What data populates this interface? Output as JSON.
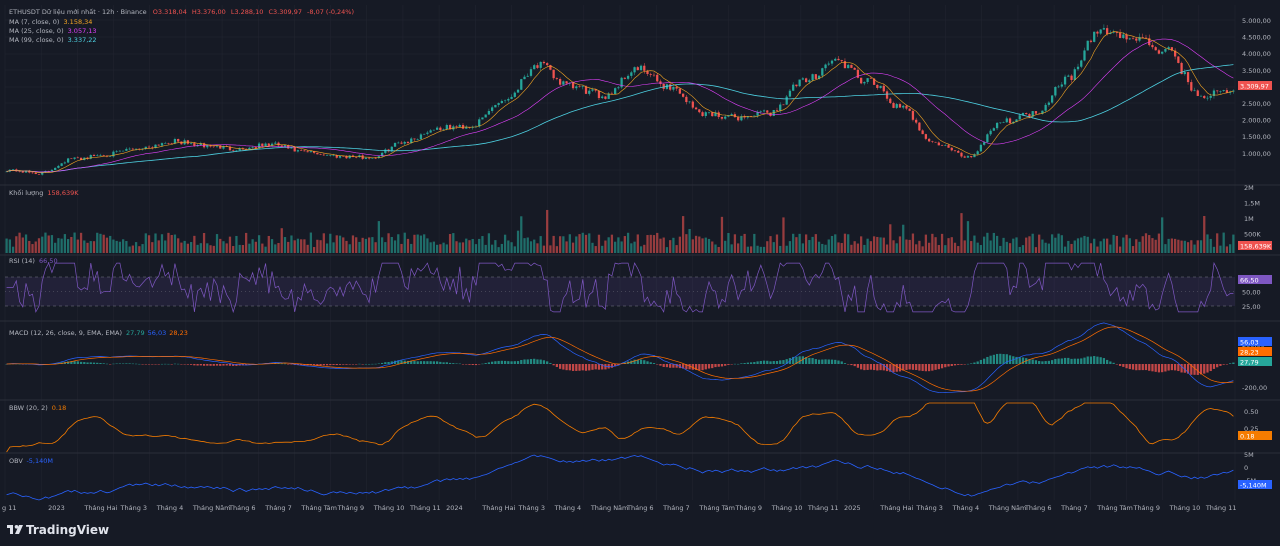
{
  "header": {
    "symbol_line": "ETHUSDT Dữ liệu mới nhất · 12h · Binance",
    "open": "O3.318,04",
    "high": "H3.376,00",
    "low": "L3.288,10",
    "close": "C3.309,97",
    "change": "-8,07 (-0,24%)"
  },
  "ma_legend": [
    {
      "label": "MA (7, close, 0)",
      "value": "3.158,34",
      "color": "#f5a623"
    },
    {
      "label": "MA (25, close, 0)",
      "value": "3.057,13",
      "color": "#e040fb"
    },
    {
      "label": "MA (99, close, 0)",
      "value": "3.337,22",
      "color": "#4dd0e1"
    }
  ],
  "panes": {
    "volume": {
      "label": "Khối lượng",
      "value": "158,639K",
      "badge": "158,639K"
    },
    "rsi": {
      "label": "RSI (14)",
      "value": "66,50",
      "badge": "66,50"
    },
    "macd": {
      "label": "MACD (12, 26, close, 9, EMA, EMA)",
      "v1": "27,79",
      "v2": "56,03",
      "v3": "28,23"
    },
    "bbw": {
      "label": "BBW (20, 2)",
      "value": "0.18",
      "badge": "0.18"
    },
    "obv": {
      "label": "OBV",
      "value": "-5,140M",
      "badge": "-5,140M"
    }
  },
  "price_badge": "3.309,97",
  "price_axis": [
    "5.000,00",
    "4.500,00",
    "4.000,00",
    "3.500,00",
    "3.000,00",
    "2.500,00",
    "2.000,00",
    "1.500,00",
    "1.000,00"
  ],
  "volume_axis": [
    "2M",
    "1,5M",
    "1M",
    "500K"
  ],
  "rsi_axis": [
    "75,00",
    "50,00",
    "25,00"
  ],
  "macd_axis": [
    "200,00",
    "-200,00"
  ],
  "bbw_axis": [
    "0.50",
    "0.25"
  ],
  "obv_axis": [
    "5M",
    "0",
    "-5M"
  ],
  "time_axis": [
    "g 11",
    "2023",
    "Tháng Hai",
    "Tháng 3",
    "Tháng 4",
    "Tháng Năm",
    "Tháng 6",
    "Tháng 7",
    "Tháng Tám",
    "Tháng 9",
    "Tháng 10",
    "Tháng 11",
    "2024",
    "Tháng Hai",
    "Tháng 3",
    "Tháng 4",
    "Tháng Năm",
    "Tháng 6",
    "Tháng 7",
    "Tháng Tám",
    "Tháng 9",
    "Tháng 10",
    "Tháng 11",
    "2025",
    "Tháng Hai",
    "Tháng 3",
    "Tháng 4",
    "Tháng Năm",
    "Tháng 6",
    "Tháng 7",
    "Tháng Tám",
    "Tháng 9",
    "Tháng 10",
    "Tháng 11"
  ],
  "brand": "TradingView",
  "colors": {
    "up": "#26a69a",
    "down": "#ef5350",
    "rsi": "#7e57c2",
    "bbw": "#f57c00",
    "obv": "#2962ff",
    "ma7": "#f5a623",
    "ma25": "#e040fb",
    "ma99": "#4dd0e1"
  },
  "chart_data": {
    "type": "line",
    "title": "ETHUSDT · 12h · Binance",
    "ylim": [
      1000,
      5000
    ],
    "x": [
      "2022-11",
      "2022-12",
      "2023-01",
      "2023-02",
      "2023-03",
      "2023-04",
      "2023-05",
      "2023-06",
      "2023-07",
      "2023-08",
      "2023-09",
      "2023-10",
      "2023-11",
      "2023-12",
      "2024-01",
      "2024-02",
      "2024-03",
      "2024-04",
      "2024-05",
      "2024-06",
      "2024-07",
      "2024-08",
      "2024-09",
      "2024-10",
      "2024-11",
      "2024-12",
      "2025-01",
      "2025-02",
      "2025-03",
      "2025-04",
      "2025-05",
      "2025-06",
      "2025-07",
      "2025-08",
      "2025-09",
      "2025-10",
      "2025-11",
      "2025-12"
    ],
    "series": [
      {
        "values": [
          1300,
          1220,
          1550,
          1650,
          1800,
          1950,
          1850,
          1780,
          1880,
          1700,
          1620,
          1580,
          1950,
          2250,
          2300,
          2900,
          3700,
          3200,
          3000,
          3600,
          3200,
          2600,
          2500,
          2600,
          3300,
          3800,
          3300,
          2700,
          1900,
          1600,
          2400,
          2600,
          3400,
          4500,
          4300,
          4000,
          3000,
          3100
        ]
      }
    ]
  }
}
